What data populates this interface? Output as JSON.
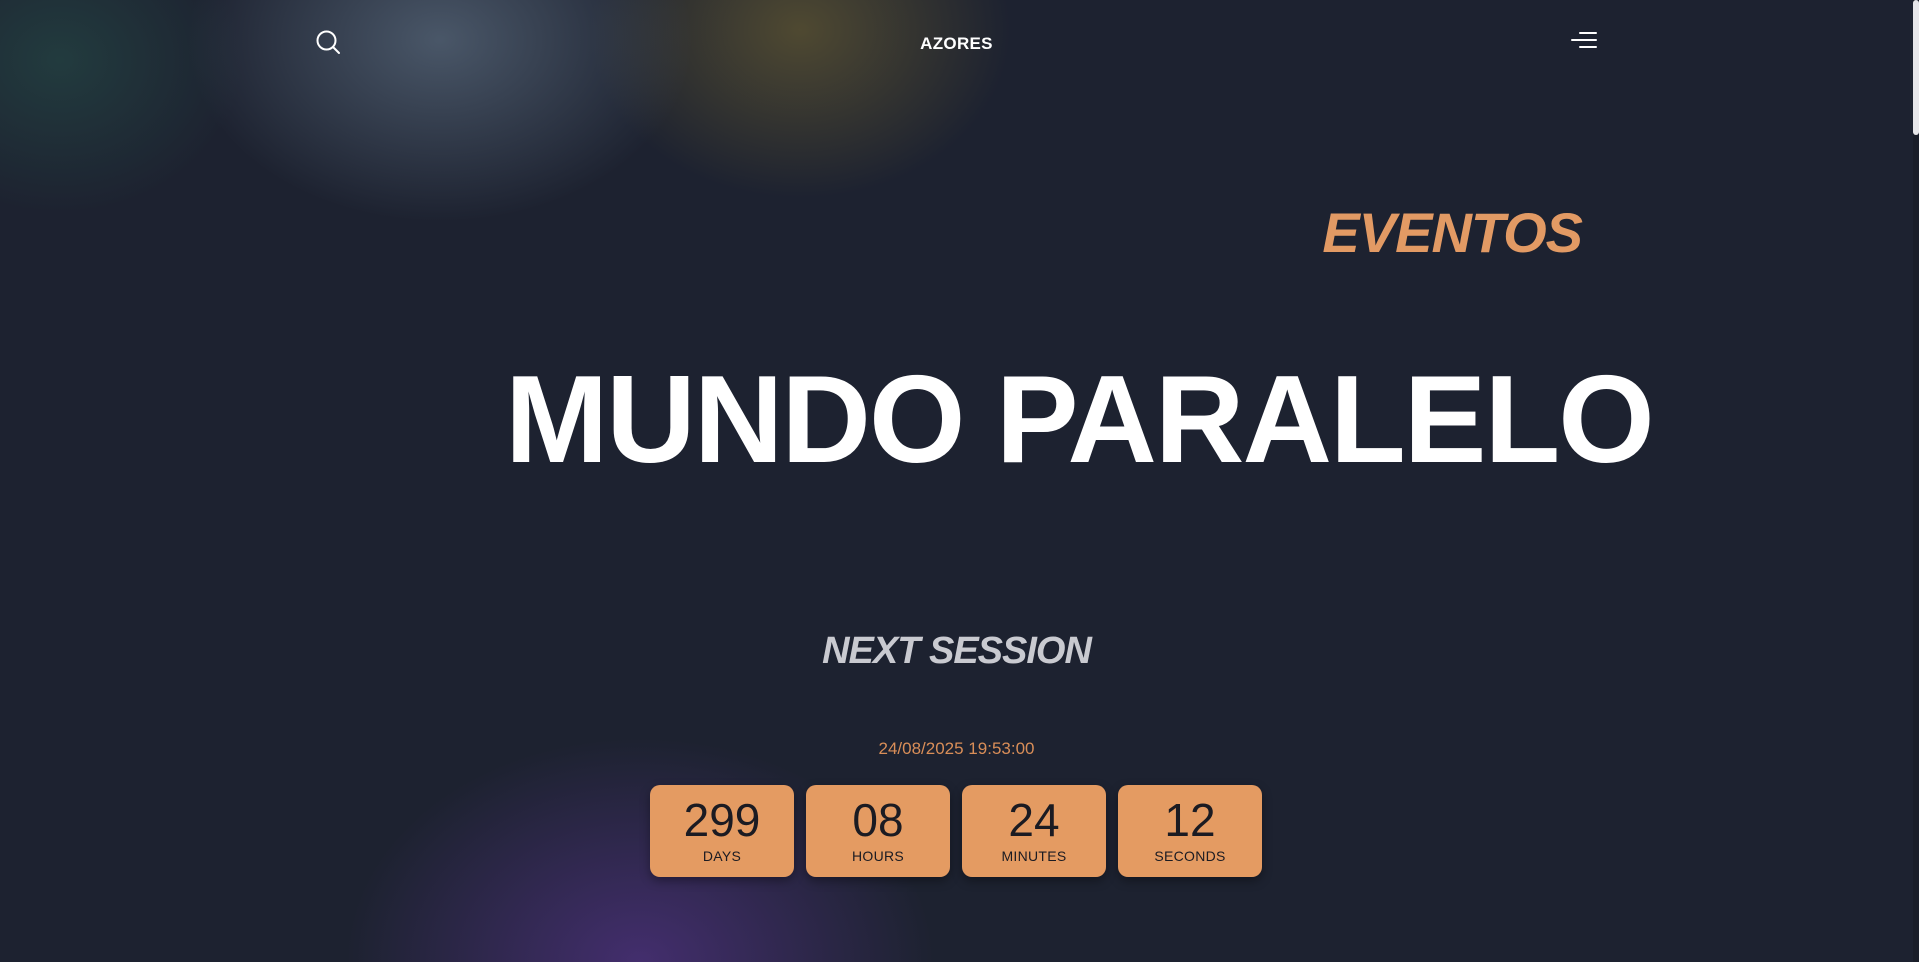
{
  "header": {
    "brand": "AZORES",
    "search_icon": "search-icon",
    "menu_icon": "menu-icon"
  },
  "hero": {
    "category": "EVENTOS",
    "title": "MUNDO PARALELO"
  },
  "session": {
    "heading": "NEXT SESSION",
    "datetime": "24/08/2025 19:53:00",
    "countdown": [
      {
        "value": "299",
        "label": "DAYS"
      },
      {
        "value": "08",
        "label": "HOURS"
      },
      {
        "value": "24",
        "label": "MINUTES"
      },
      {
        "value": "12",
        "label": "SECONDS"
      }
    ]
  },
  "colors": {
    "accent": "#e49b62",
    "background": "#1d2230",
    "text": "#ffffff"
  }
}
